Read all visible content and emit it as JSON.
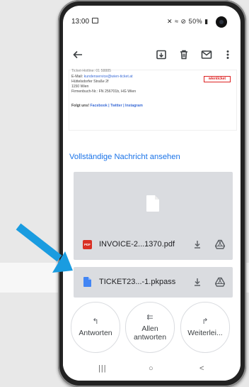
{
  "status_bar": {
    "time": "13:00",
    "icons_text": "\u0004 \u0004 \u0004",
    "battery": "50%"
  },
  "toolbar": {
    "back_icon": "arrow-left-icon",
    "archive_icon": "archive-icon",
    "delete_icon": "trash-icon",
    "mark_unread_icon": "mail-icon",
    "more_icon": "more-vertical-icon"
  },
  "mail_content": {
    "line1_label": "E-Mail: ",
    "line1_link": "kundenservice@wien-ticket.at",
    "line2": "Hüttelsdorfer Straße 2f",
    "line3": "1150 Wien",
    "line4": "Firmenbuch-Nr.: FN 256701b, HG Wien",
    "follow_label": "Folgt uns! ",
    "follow_links": "Facebook | Twitter | Instagram",
    "top_clip": "Ticket-Hotline: 01 58885",
    "logo_text": "wienticket"
  },
  "view_full_message": "Vollständige Nachricht ansehen",
  "attachments": [
    {
      "name": "INVOICE-2...1370.pdf",
      "type_icon": "pdf-icon",
      "badge": "PDF"
    },
    {
      "name": "TICKET23...-1.pkpass",
      "type_icon": "file-icon"
    }
  ],
  "reply_actions": [
    {
      "glyph": "↰",
      "label": "Antworten"
    },
    {
      "glyph": "⇇",
      "label": "Allen antworten"
    },
    {
      "glyph": "↱",
      "label": "Weiterlei..."
    }
  ],
  "nav": {
    "recents": "|||",
    "home": "○",
    "back": "<"
  },
  "colors": {
    "link_blue": "#1a73e8",
    "card_bg": "#dadce0",
    "pdf_red": "#d93025",
    "file_blue": "#4285f4",
    "arrow_blue": "#1a9ce0"
  }
}
